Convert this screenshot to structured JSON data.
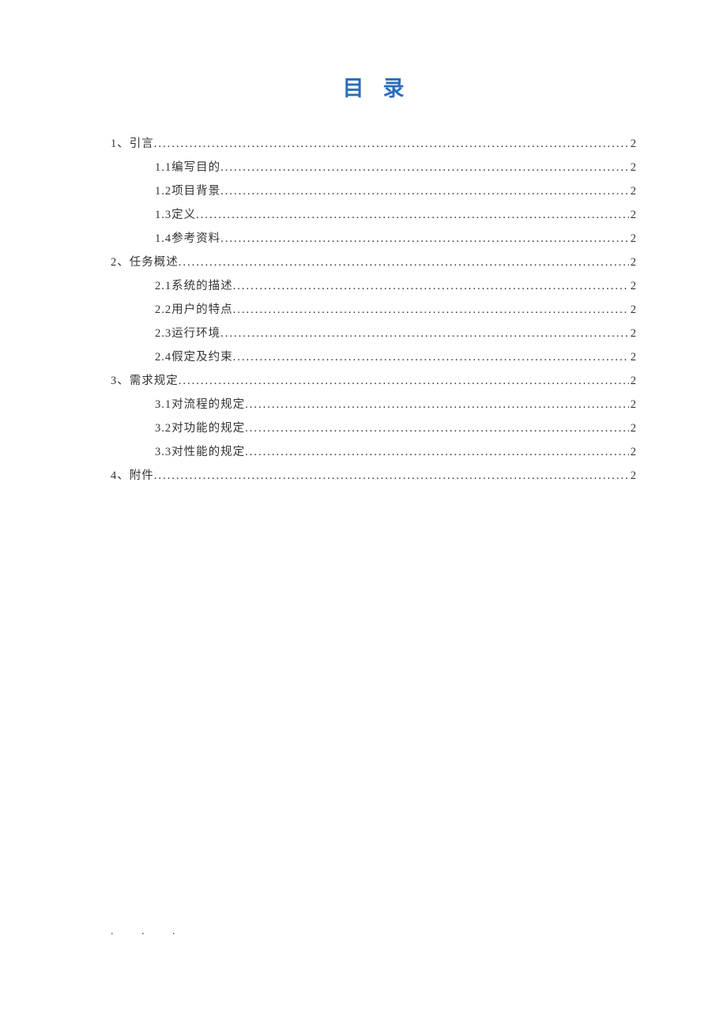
{
  "title": "目录",
  "footer": ". . .",
  "toc": [
    {
      "level": 0,
      "label": "1、引言",
      "page": "2"
    },
    {
      "level": 1,
      "label": "1.1编写目的",
      "page": "2"
    },
    {
      "level": 1,
      "label": "1.2项目背景",
      "page": "2"
    },
    {
      "level": 1,
      "label": "1.3定义",
      "page": "2"
    },
    {
      "level": 1,
      "label": "1.4参考资料",
      "page": "2"
    },
    {
      "level": 0,
      "label": "2、任务概述",
      "page": "2"
    },
    {
      "level": 1,
      "label": "2.1系统的描述",
      "page": "2"
    },
    {
      "level": 1,
      "label": "2.2用户的特点",
      "page": "2"
    },
    {
      "level": 1,
      "label": "2.3运行环境",
      "page": "2"
    },
    {
      "level": 1,
      "label": "2.4假定及约束",
      "page": "2"
    },
    {
      "level": 0,
      "label": "3、需求规定",
      "page": "2"
    },
    {
      "level": 1,
      "label": "3.1对流程的规定",
      "page": "2"
    },
    {
      "level": 1,
      "label": "3.2对功能的规定",
      "page": "2"
    },
    {
      "level": 1,
      "label": "3.3对性能的规定",
      "page": "2"
    },
    {
      "level": 0,
      "label": "4、附件",
      "page": "2"
    }
  ]
}
